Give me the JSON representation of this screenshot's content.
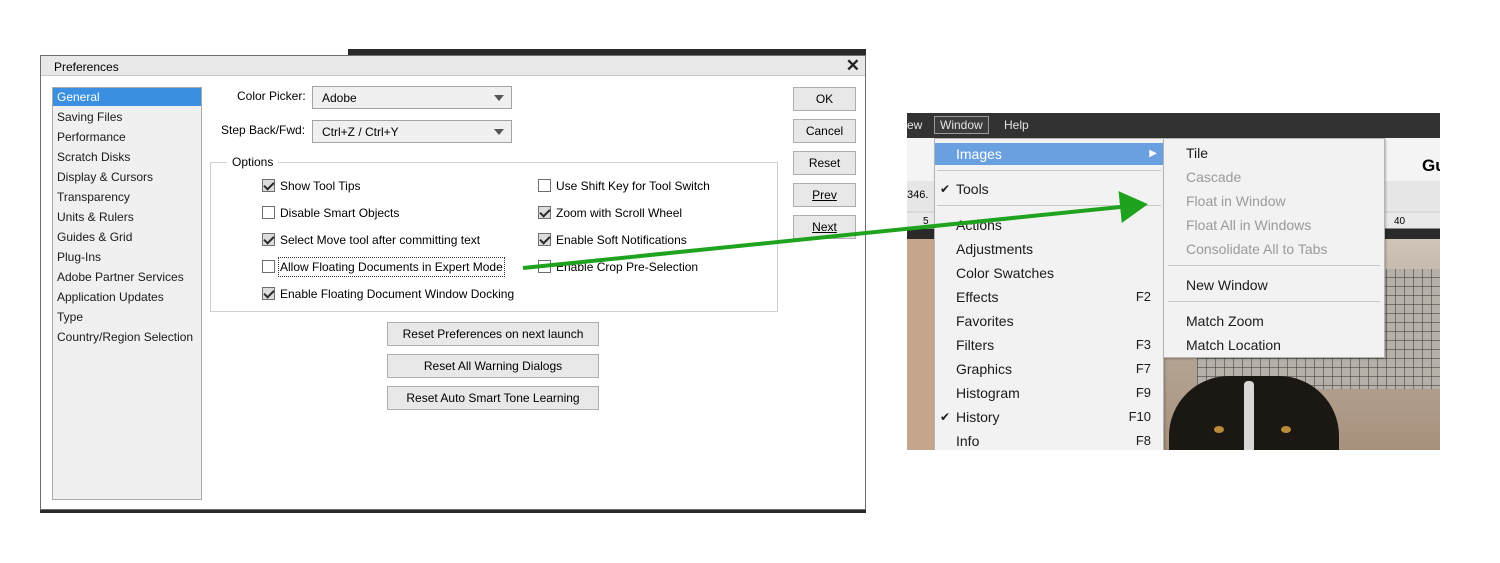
{
  "dialog": {
    "title": "Preferences",
    "categories": [
      {
        "label": "General",
        "selected": true
      },
      {
        "label": "Saving Files"
      },
      {
        "label": "Performance"
      },
      {
        "label": "Scratch Disks"
      },
      {
        "label": "Display & Cursors"
      },
      {
        "label": "Transparency"
      },
      {
        "label": "Units & Rulers"
      },
      {
        "label": "Guides & Grid"
      },
      {
        "label": "Plug-Ins"
      },
      {
        "label": "Adobe Partner Services"
      },
      {
        "label": "Application Updates"
      },
      {
        "label": "Type"
      },
      {
        "label": "Country/Region Selection"
      }
    ],
    "color_picker_label": "Color Picker:",
    "color_picker_value": "Adobe",
    "step_label": "Step Back/Fwd:",
    "step_value": "Ctrl+Z / Ctrl+Y",
    "options_legend": "Options",
    "options": [
      {
        "label": "Show Tool Tips",
        "checked": true
      },
      {
        "label": "Disable Smart Objects",
        "checked": false
      },
      {
        "label": "Select Move tool after committing text",
        "checked": true
      },
      {
        "label": "Allow Floating Documents in Expert Mode",
        "checked": false
      },
      {
        "label": "Enable Floating Document Window Docking",
        "checked": true
      },
      {
        "label": "Use Shift Key for Tool Switch",
        "checked": false
      },
      {
        "label": "Zoom with Scroll Wheel",
        "checked": true
      },
      {
        "label": "Enable Soft Notifications",
        "checked": true
      },
      {
        "label": "Enable Crop Pre-Selection",
        "checked": false
      }
    ],
    "buttons": {
      "ok": "OK",
      "cancel": "Cancel",
      "reset": "Reset",
      "prev": "Prev",
      "next": "Next",
      "reset_prefs": "Reset Preferences on next launch",
      "reset_warnings": "Reset All Warning Dialogs",
      "reset_tone": "Reset Auto Smart Tone Learning"
    }
  },
  "menu_screenshot": {
    "menubar": {
      "prev": "ew",
      "window": "Window",
      "help": "Help"
    },
    "options_text": "Gu",
    "ruler_readout": "346.",
    "ruler_ticks": [
      "5",
      "40"
    ],
    "window_menu": [
      {
        "label": "Images",
        "highlighted": true,
        "submenu": true
      },
      {
        "label": "Tools",
        "checked": true
      },
      {
        "label": "Actions"
      },
      {
        "label": "Adjustments"
      },
      {
        "label": "Color Swatches"
      },
      {
        "label": "Effects",
        "shortcut": "F2"
      },
      {
        "label": "Favorites"
      },
      {
        "label": "Filters",
        "shortcut": "F3"
      },
      {
        "label": "Graphics",
        "shortcut": "F7"
      },
      {
        "label": "Histogram",
        "shortcut": "F9"
      },
      {
        "label": "History",
        "shortcut": "F10",
        "checked": true
      },
      {
        "label": "Info",
        "shortcut": "F8"
      }
    ],
    "images_submenu": [
      {
        "label": "Tile",
        "enabled": true
      },
      {
        "label": "Cascade",
        "enabled": false
      },
      {
        "label": "Float in Window",
        "enabled": false
      },
      {
        "label": "Float All in Windows",
        "enabled": false
      },
      {
        "label": "Consolidate All to Tabs",
        "enabled": false
      },
      {
        "label": "New Window",
        "enabled": true
      },
      {
        "label": "Match Zoom",
        "enabled": true
      },
      {
        "label": "Match Location",
        "enabled": true
      }
    ],
    "check_glyph": "✔",
    "submenu_glyph": "▶"
  },
  "annotation": {
    "arrow_color": "#1fa31f"
  },
  "colors": {
    "selection": "#3b8fe0",
    "menu_highlight": "#6aa0e0",
    "menubar": "#323232"
  }
}
